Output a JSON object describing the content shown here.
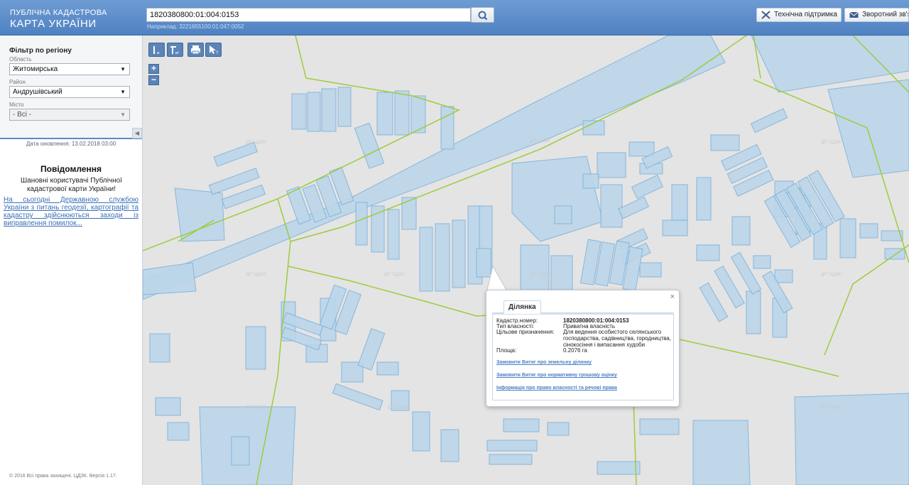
{
  "header": {
    "logo_line1": "ПУБЛІЧНА КАДАСТРОВА",
    "logo_line2": "КАРТА УКРАЇНИ",
    "search_value": "1820380800:01:004:0153",
    "search_example": "Наприклад: 3221655100:01:047:0052",
    "support_label": "Технічна підтримка",
    "feedback_label": "Зворотний зв'язок"
  },
  "sidebar": {
    "filter_title": "Фільтр по регіону",
    "oblast_label": "Область",
    "oblast_value": "Житомирська",
    "raion_label": "Район",
    "raion_value": "Андрушівський",
    "misto_label": "Місто",
    "misto_value": "- Всі -",
    "update_date": "Дата оновлення: 13.02.2018 03:00",
    "news_title": "Повідомлення",
    "news_body": "Шановні користувачі Публічної кадастрової карти України!",
    "news_link": "На сьогодні Державною службою України з питань геодезії, картографії та кадастру здійснюються заходи із виправлення помилок...",
    "copyright": "© 2016 Всі права захищені. ЦДЗК. Версія 1.17."
  },
  "map": {
    "tools": {
      "measure_line": "I м",
      "measure_area": "I м²",
      "print_icon": "printer-icon",
      "identify_icon": "identify-icon"
    },
    "zoom_in": "+",
    "zoom_out": "−",
    "watermark": "ДП \"ЦДЗК\"",
    "parcel_color": "#bcd6ea",
    "boundary_color": "#9ccc3c"
  },
  "popup": {
    "tab": "Ділянка",
    "close": "×",
    "cadastr_label": "Кадастр.номер:",
    "cadastr_value": "1820380800:01:004:0153",
    "ownership_label": "Тип власності:",
    "ownership_value": "Приватна власність",
    "purpose_label": "Цільове призначення:",
    "purpose_value": "Для ведення особистого селянського господарства, садівництва, городництва, сінокосіння і випасання худоби",
    "area_label": "Площа:",
    "area_value": "0.2076 га",
    "link1": "Замовити Витяг про земельну ділянку",
    "link2": "Замовити Витяг про нормативну грошову оцінку",
    "link3": "Інформація про право власності та речові права"
  }
}
